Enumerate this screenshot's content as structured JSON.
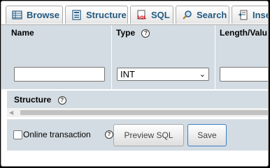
{
  "tabs": [
    {
      "label": "Browse",
      "icon": "table-icon"
    },
    {
      "label": "Structure",
      "icon": "structure-icon"
    },
    {
      "label": "SQL",
      "icon": "sql-icon"
    },
    {
      "label": "Search",
      "icon": "search-icon"
    },
    {
      "label": "Inse",
      "icon": "insert-icon"
    }
  ],
  "columns": {
    "name": "Name",
    "type": "Type",
    "length": "Length/Valu"
  },
  "row": {
    "name_value": "",
    "type_value": "INT",
    "length_value": ""
  },
  "structure": {
    "label": "Structure"
  },
  "footer": {
    "online_transaction_label": "Online transaction",
    "preview_label": "Preview SQL",
    "save_label": "Save"
  },
  "colors": {
    "tab_text": "#235a81",
    "header_bg": "#d3dce3",
    "save_border": "#3a7fc8"
  }
}
